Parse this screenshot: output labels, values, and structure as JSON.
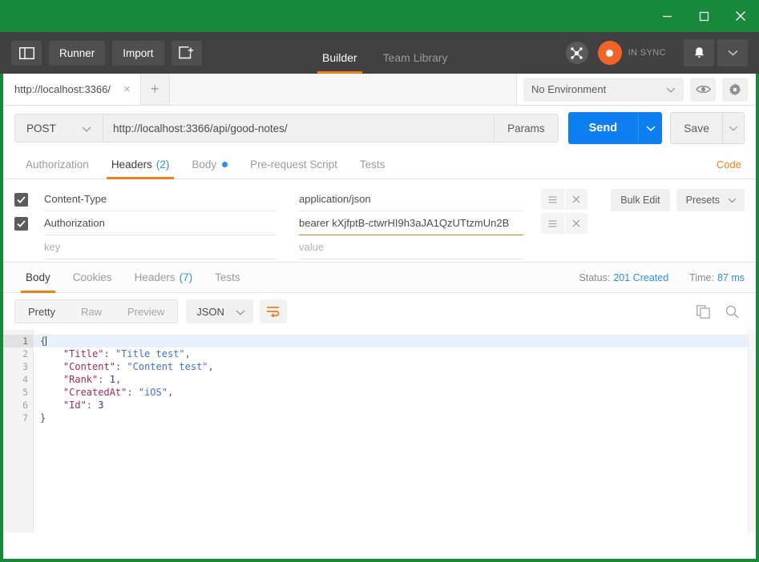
{
  "window": {
    "minimize_label": "minimize-icon",
    "maximize_label": "maximize-icon",
    "close_label": "close-icon",
    "chrome_color": "#18883a"
  },
  "header": {
    "sidebar_toggle_icon": "sidebar-toggle-icon",
    "runner_label": "Runner",
    "import_label": "Import",
    "new_window_icon": "new-window-icon",
    "nav_tabs": [
      {
        "label": "Builder",
        "active": true
      },
      {
        "label": "Team Library",
        "active": false
      }
    ],
    "network_icon": "network-icon",
    "sync_status": "IN SYNC",
    "bell_icon": "bell-icon",
    "account_caret_icon": "chevron-down-icon",
    "accent_color": "#ef7f1a"
  },
  "tabbar": {
    "tabs": [
      {
        "title": "http://localhost:3366/",
        "close": "×"
      }
    ],
    "add_label": "+",
    "environment": {
      "selected": "No Environment",
      "caret": "chevron-down-icon",
      "eye_icon": "eye-icon",
      "gear_icon": "gear-icon"
    }
  },
  "request": {
    "method": "POST",
    "url": "http://localhost:3366/api/good-notes/",
    "params_label": "Params",
    "send_label": "Send",
    "send_caret": "chevron-down-icon",
    "save_label": "Save",
    "save_caret": "chevron-down-icon",
    "tabs": [
      {
        "label": "Authorization",
        "active": false
      },
      {
        "label": "Headers",
        "count": "(2)",
        "active": true
      },
      {
        "label": "Body",
        "dot": true,
        "active": false
      },
      {
        "label": "Pre-request Script",
        "active": false
      },
      {
        "label": "Tests",
        "active": false
      }
    ],
    "code_link": "Code"
  },
  "headers_table": {
    "bulk_edit_label": "Bulk Edit",
    "presets_label": "Presets",
    "key_placeholder": "key",
    "value_placeholder": "value",
    "rows": [
      {
        "checked": true,
        "key": "Content-Type",
        "value": "application/json",
        "focused": false,
        "menu_icon": "list-menu-icon",
        "delete_icon": "close-icon"
      },
      {
        "checked": true,
        "key": "Authorization",
        "value": "bearer kXjfptB-ctwrHI9h3aJA1QzUTtzmUn2B",
        "focused": true,
        "menu_icon": "list-menu-icon",
        "delete_icon": "close-icon"
      }
    ]
  },
  "response": {
    "tabs": [
      {
        "label": "Body",
        "active": true
      },
      {
        "label": "Cookies",
        "active": false
      },
      {
        "label": "Headers",
        "count": "(7)",
        "active": false
      },
      {
        "label": "Tests",
        "active": false
      }
    ],
    "status_label": "Status:",
    "status_value": "201 Created",
    "time_label": "Time:",
    "time_value": "87 ms",
    "view_modes": [
      {
        "label": "Pretty",
        "active": true
      },
      {
        "label": "Raw",
        "active": false
      },
      {
        "label": "Preview",
        "active": false
      }
    ],
    "format": "JSON",
    "format_caret": "chevron-down-icon",
    "wrap_icon": "word-wrap-icon",
    "copy_icon": "copy-icon",
    "search_icon": "search-icon",
    "body_lines": [
      {
        "num": "1",
        "fold": true,
        "segments": [
          {
            "t": "{",
            "c": "p"
          }
        ],
        "highlight": true,
        "caret": true
      },
      {
        "num": "2",
        "segments": [
          {
            "t": "    ",
            "c": "p"
          },
          {
            "t": "\"Title\"",
            "c": "k"
          },
          {
            "t": ": ",
            "c": "p"
          },
          {
            "t": "\"Title test\"",
            "c": "s"
          },
          {
            "t": ",",
            "c": "p"
          }
        ]
      },
      {
        "num": "3",
        "segments": [
          {
            "t": "    ",
            "c": "p"
          },
          {
            "t": "\"Content\"",
            "c": "k"
          },
          {
            "t": ": ",
            "c": "p"
          },
          {
            "t": "\"Content test\"",
            "c": "s"
          },
          {
            "t": ",",
            "c": "p"
          }
        ]
      },
      {
        "num": "4",
        "segments": [
          {
            "t": "    ",
            "c": "p"
          },
          {
            "t": "\"Rank\"",
            "c": "k"
          },
          {
            "t": ": ",
            "c": "p"
          },
          {
            "t": "1",
            "c": "n"
          },
          {
            "t": ",",
            "c": "p"
          }
        ]
      },
      {
        "num": "5",
        "segments": [
          {
            "t": "    ",
            "c": "p"
          },
          {
            "t": "\"CreatedAt\"",
            "c": "k"
          },
          {
            "t": ": ",
            "c": "p"
          },
          {
            "t": "\"iOS\"",
            "c": "s"
          },
          {
            "t": ",",
            "c": "p"
          }
        ]
      },
      {
        "num": "6",
        "segments": [
          {
            "t": "    ",
            "c": "p"
          },
          {
            "t": "\"Id\"",
            "c": "k"
          },
          {
            "t": ": ",
            "c": "p"
          },
          {
            "t": "3",
            "c": "n"
          }
        ]
      },
      {
        "num": "7",
        "segments": [
          {
            "t": "}",
            "c": "p"
          }
        ]
      }
    ]
  }
}
